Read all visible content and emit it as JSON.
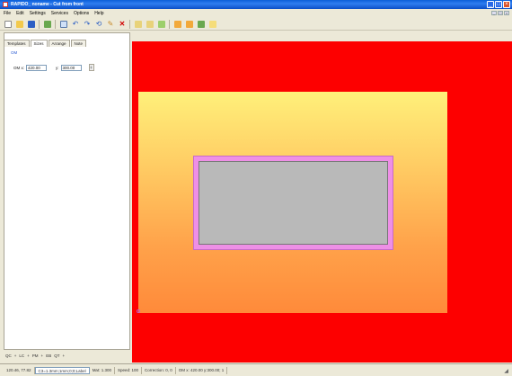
{
  "window": {
    "title": "RAPIDO_ noname - Cut from front"
  },
  "menu": [
    "File",
    "Edit",
    "Settings",
    "Services",
    "Options",
    "Help"
  ],
  "tabs": [
    "Templates",
    "Sizes",
    "Arrange",
    "Note"
  ],
  "active_tab": "Sizes",
  "panel": {
    "group_label": "OM",
    "om_x_label": "OM x:",
    "om_x_value": "420.00",
    "om_y_label": "y:",
    "om_y_value": "300.00",
    "spin_glyph": "‡"
  },
  "left_bottom": [
    "QC",
    "+",
    "LC",
    "+",
    "PM",
    "+",
    "EB",
    "QT",
    "+"
  ],
  "status": {
    "coords": "120.46, 77.82",
    "dimensions": "C3=1.3mm;1mm;0;0;Label",
    "mat": "Mat: 1.300",
    "speed": "Speed: 100",
    "correction": "Correction: 0, 0",
    "om": "OM x: 420.00 y:300.00; 1"
  },
  "colors": {
    "canvas": "#fd0000",
    "board_top": "#fff07a",
    "board_bottom": "#ff8a3a",
    "cut_border": "#ee8fe6",
    "cut_fill": "#b9b9b9"
  }
}
